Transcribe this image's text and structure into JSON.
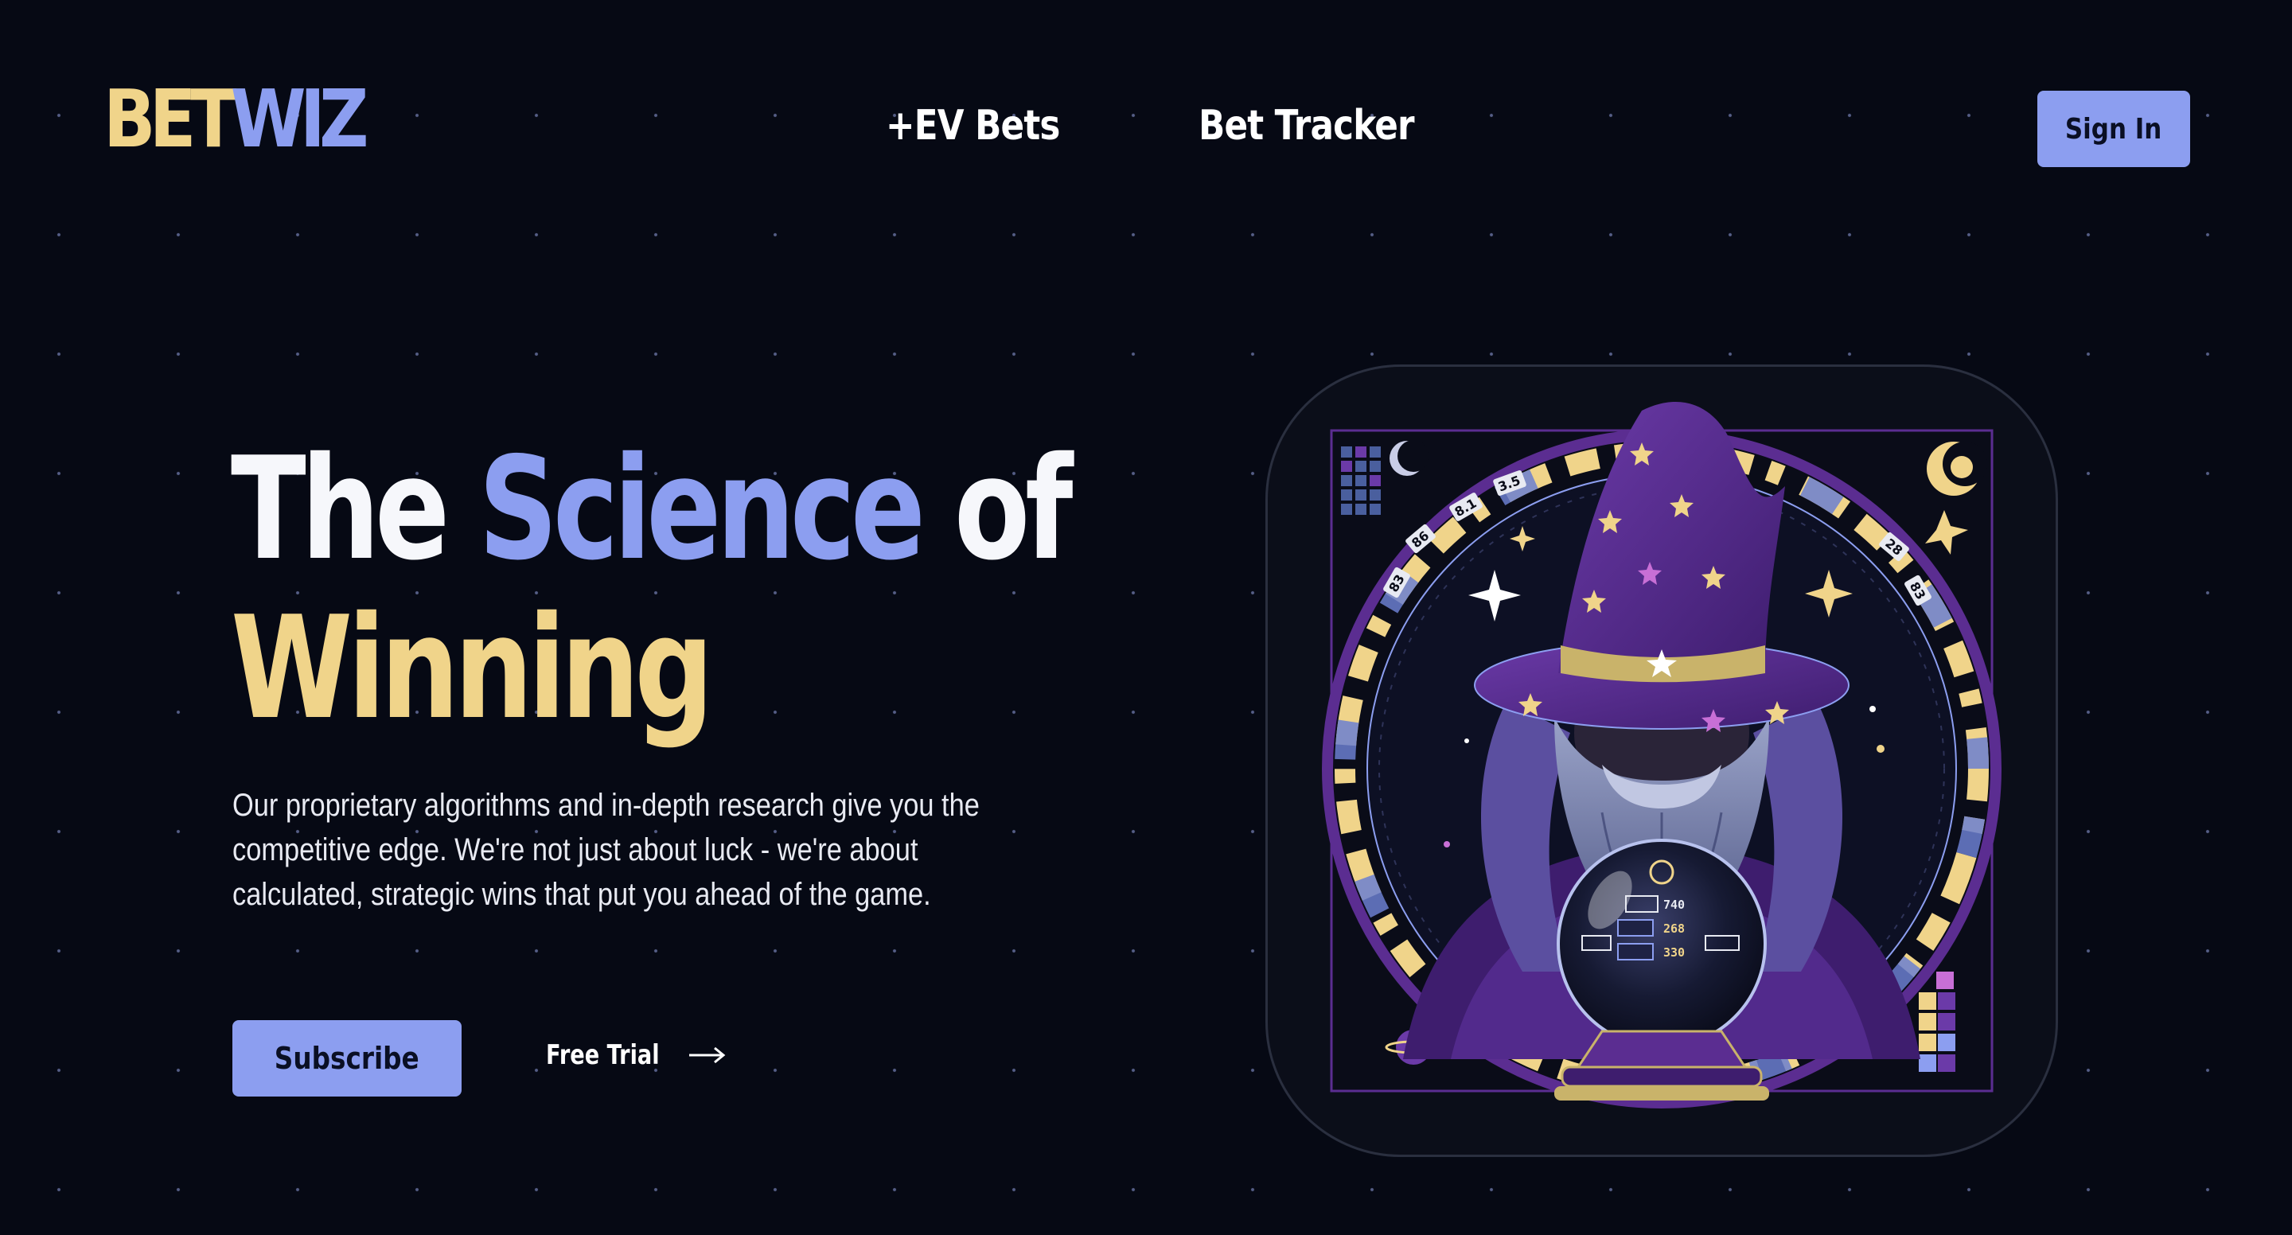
{
  "header": {
    "logo": {
      "part1": "BET",
      "part2": "WIZ"
    },
    "nav": [
      {
        "label": "+EV Bets"
      },
      {
        "label": "Bet Tracker"
      }
    ],
    "sign_in_label": "Sign In"
  },
  "hero": {
    "title": {
      "word1": "The",
      "word2": "Science",
      "word3": "of",
      "word4": "Winning"
    },
    "description": "Our proprietary algorithms and in-depth research give you the competitive edge. We're not just about luck - we're about calculated, strategic wins that put you ahead of the game.",
    "subscribe_label": "Subscribe",
    "free_trial_label": "Free Trial",
    "free_trial_icon": "arrow-right-icon"
  },
  "illustration": {
    "subject": "wizard-with-crystal-ball",
    "dial_labels_left": [
      "86",
      "83",
      "8.1",
      "3.5"
    ],
    "dial_labels_right": [
      "28",
      "83"
    ],
    "orb_readouts": [
      "740",
      "268",
      "330"
    ]
  },
  "colors": {
    "background": "#060914",
    "accent_blue": "#8c9ef0",
    "accent_gold": "#f0d48a",
    "purple": "#5b2d91",
    "text": "#ffffff"
  }
}
